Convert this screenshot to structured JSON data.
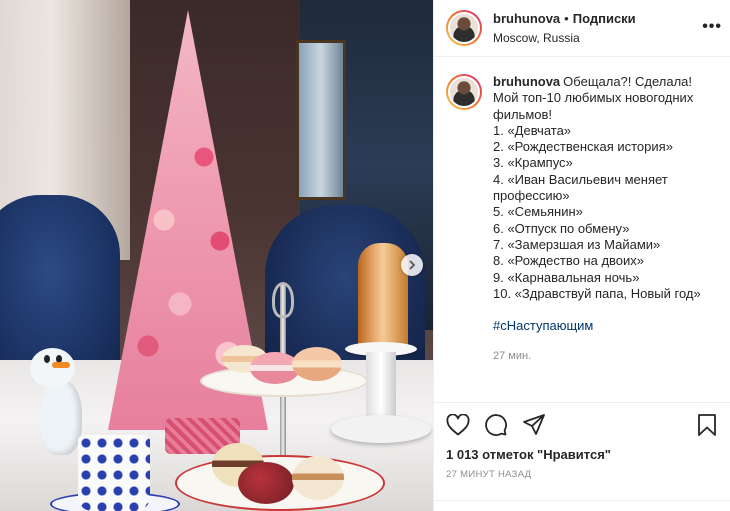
{
  "header": {
    "username": "bruhunova",
    "separator": "•",
    "follow_label": "Подписки",
    "location": "Moscow, Russia",
    "more_label": "•••"
  },
  "caption": {
    "username": "bruhunova",
    "lines": [
      "Обещала?! Сделала!",
      "Мой топ-10 любимых новогодних",
      "фильмов!",
      "",
      "1. «Девчата»",
      "2. «Рождественская история»",
      "3. «Крампус»",
      "4. «Иван Васильевич меняет",
      "профессию»",
      "5. «Семьянин»",
      "6. «Отпуск по обмену»",
      "7. «Замерзшая из Майами»",
      "8. «Рождество на двоих»",
      "9. «Карнавальная ночь»",
      "10. «Здравствуй папа, Новый год»"
    ],
    "hashtag": "#сНаступающим",
    "time": "27 мин."
  },
  "actions": {
    "icons": [
      "heart-icon",
      "comment-icon",
      "share-icon",
      "bookmark-icon"
    ],
    "likes": "1 013 отметок \"Нравится\"",
    "timestamp": "27 МИНУТ НАЗАД"
  },
  "colors": {
    "hashtag": "#00376b",
    "text": "#262626",
    "muted": "#8e8e8e",
    "border": "#efefef"
  }
}
